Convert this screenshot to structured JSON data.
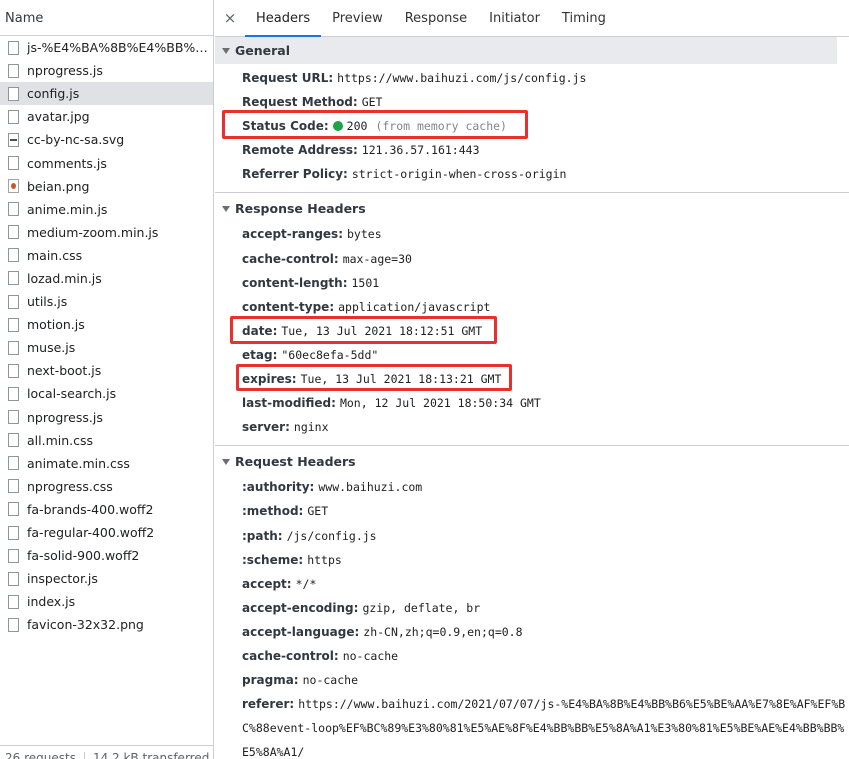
{
  "left": {
    "header": "Name",
    "files": [
      {
        "name": "js-%E4%BA%8B%E4%BB%B6...",
        "icon": "file-icon"
      },
      {
        "name": "nprogress.js",
        "icon": "file-icon"
      },
      {
        "name": "config.js",
        "icon": "file-icon",
        "selected": true
      },
      {
        "name": "avatar.jpg",
        "icon": "image-file-icon"
      },
      {
        "name": "cc-by-nc-sa.svg",
        "icon": "svg-file-icon"
      },
      {
        "name": "comments.js",
        "icon": "file-icon"
      },
      {
        "name": "beian.png",
        "icon": "image-file-icon"
      },
      {
        "name": "anime.min.js",
        "icon": "file-icon"
      },
      {
        "name": "medium-zoom.min.js",
        "icon": "file-icon"
      },
      {
        "name": "main.css",
        "icon": "file-icon"
      },
      {
        "name": "lozad.min.js",
        "icon": "file-icon"
      },
      {
        "name": "utils.js",
        "icon": "file-icon"
      },
      {
        "name": "motion.js",
        "icon": "file-icon"
      },
      {
        "name": "muse.js",
        "icon": "file-icon"
      },
      {
        "name": "next-boot.js",
        "icon": "file-icon"
      },
      {
        "name": "local-search.js",
        "icon": "file-icon"
      },
      {
        "name": "nprogress.js",
        "icon": "file-icon"
      },
      {
        "name": "all.min.css",
        "icon": "file-icon"
      },
      {
        "name": "animate.min.css",
        "icon": "file-icon"
      },
      {
        "name": "nprogress.css",
        "icon": "file-icon"
      },
      {
        "name": "fa-brands-400.woff2",
        "icon": "file-icon"
      },
      {
        "name": "fa-regular-400.woff2",
        "icon": "file-icon"
      },
      {
        "name": "fa-solid-900.woff2",
        "icon": "file-icon"
      },
      {
        "name": "inspector.js",
        "icon": "file-icon"
      },
      {
        "name": "index.js",
        "icon": "file-icon"
      },
      {
        "name": "favicon-32x32.png",
        "icon": "file-icon"
      }
    ],
    "footer": {
      "requests": "26 requests",
      "transferred": "14.2 kB transferred"
    }
  },
  "tabs": {
    "close": "×",
    "items": [
      "Headers",
      "Preview",
      "Response",
      "Initiator",
      "Timing"
    ],
    "active": "Headers"
  },
  "general": {
    "title": "General",
    "request_url": {
      "key": "Request URL:",
      "value": "https://www.baihuzi.com/js/config.js"
    },
    "request_method": {
      "key": "Request Method:",
      "value": "GET"
    },
    "status_code": {
      "key": "Status Code:",
      "value": "200",
      "note": "(from memory cache)",
      "dot_color": "#1ea446"
    },
    "remote_address": {
      "key": "Remote Address:",
      "value": "121.36.57.161:443"
    },
    "referrer_policy": {
      "key": "Referrer Policy:",
      "value": "strict-origin-when-cross-origin"
    }
  },
  "response_headers": {
    "title": "Response Headers",
    "rows": [
      {
        "key": "accept-ranges:",
        "value": "bytes"
      },
      {
        "key": "cache-control:",
        "value": "max-age=30"
      },
      {
        "key": "content-length:",
        "value": "1501"
      },
      {
        "key": "content-type:",
        "value": "application/javascript"
      },
      {
        "key": "date:",
        "value": "Tue, 13 Jul 2021 18:12:51 GMT"
      },
      {
        "key": "etag:",
        "value": "\"60ec8efa-5dd\""
      },
      {
        "key": "expires:",
        "value": "Tue, 13 Jul 2021 18:13:21 GMT"
      },
      {
        "key": "last-modified:",
        "value": "Mon, 12 Jul 2021 18:50:34 GMT"
      },
      {
        "key": "server:",
        "value": "nginx"
      }
    ]
  },
  "request_headers": {
    "title": "Request Headers",
    "rows": [
      {
        "key": ":authority:",
        "value": "www.baihuzi.com"
      },
      {
        "key": ":method:",
        "value": "GET"
      },
      {
        "key": ":path:",
        "value": "/js/config.js"
      },
      {
        "key": ":scheme:",
        "value": "https"
      },
      {
        "key": "accept:",
        "value": "*/*"
      },
      {
        "key": "accept-encoding:",
        "value": "gzip, deflate, br"
      },
      {
        "key": "accept-language:",
        "value": "zh-CN,zh;q=0.9,en;q=0.8"
      },
      {
        "key": "cache-control:",
        "value": "no-cache"
      },
      {
        "key": "pragma:",
        "value": "no-cache"
      }
    ],
    "referer": {
      "key": "referer:",
      "value": "https://www.baihuzi.com/2021/07/07/js-%E4%BA%8B%E4%BB%B6%E5%BE%AA%E7%8E%AF%EF%BC%88event-loop%EF%BC%89%E3%80%81%E5%AE%8F%E4%BB%BB%E5%8A%A1%E3%80%81%E5%BE%AE%E4%BB%BB%E5%8A%A1/"
    }
  },
  "highlight_color": "#e8312e"
}
